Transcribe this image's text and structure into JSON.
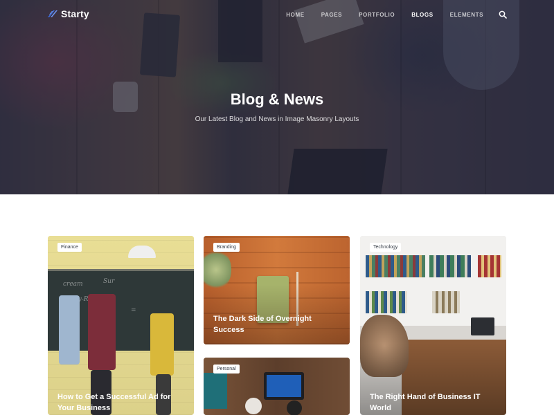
{
  "brand": {
    "name": "Starty",
    "accent": "#3b6ce0"
  },
  "nav": {
    "items": [
      {
        "label": "HOME",
        "active": false
      },
      {
        "label": "PAGES",
        "active": false
      },
      {
        "label": "PORTFOLIO",
        "active": false
      },
      {
        "label": "BLOGS",
        "active": true
      },
      {
        "label": "ELEMENTS",
        "active": false
      }
    ],
    "search_icon": "search-icon"
  },
  "hero": {
    "title": "Blog & News",
    "subtitle": "Our Latest Blog and News in Image Masonry Layouts"
  },
  "cards": [
    {
      "tag": "Finance",
      "title": "How to Get a Successful Ad for Your Business"
    },
    {
      "tag": "Branding",
      "title": "The Dark Side of Overnight Success"
    },
    {
      "tag": "Technology",
      "title": "The Right Hand of Business IT World"
    },
    {
      "tag": "Personal",
      "title": ""
    }
  ]
}
